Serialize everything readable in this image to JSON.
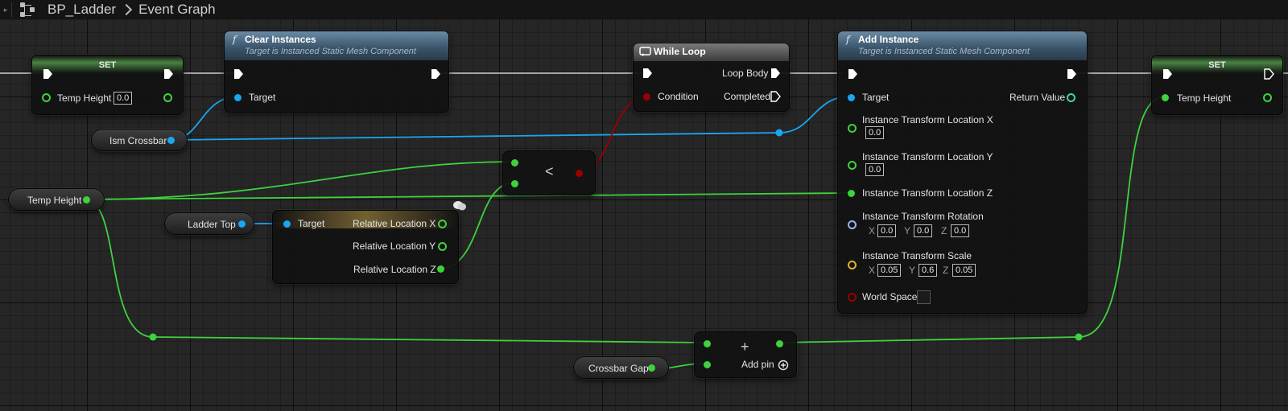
{
  "breadcrumb": {
    "asset": "BP_Ladder",
    "graph": "Event Graph"
  },
  "colors": {
    "exec": "#ffffff",
    "float": "#3fd23c",
    "object": "#1aa6f0",
    "bool": "#9b0000",
    "rotator": "#9eb1f2",
    "vector": "#e0b12e",
    "function_header": "#3c566c",
    "set_header": "#5aa650"
  },
  "nodes": {
    "set1": {
      "title": "SET",
      "pin_label": "Temp Height",
      "value": "0.0"
    },
    "clear_instances": {
      "title": "Clear Instances",
      "subtitle": "Target is Instanced Static Mesh Component",
      "target_label": "Target"
    },
    "ism_crossbar": {
      "label": "Ism Crossbar"
    },
    "temp_height": {
      "label": "Temp Height"
    },
    "ladder_top": {
      "label": "Ladder Top"
    },
    "relative_location": {
      "target_label": "Target",
      "x_label": "Relative Location X",
      "y_label": "Relative Location Y",
      "z_label": "Relative Location Z"
    },
    "less_than": {
      "op": "<"
    },
    "while_loop": {
      "title": "While Loop",
      "condition_label": "Condition",
      "loop_body_label": "Loop Body",
      "completed_label": "Completed"
    },
    "add_instance": {
      "title": "Add Instance",
      "subtitle": "Target is Instanced Static Mesh Component",
      "target_label": "Target",
      "return_label": "Return Value",
      "loc_x_label": "Instance Transform Location X",
      "loc_x_value": "0.0",
      "loc_y_label": "Instance Transform Location Y",
      "loc_y_value": "0.0",
      "loc_z_label": "Instance Transform Location Z",
      "rot_label": "Instance Transform Rotation",
      "rot": {
        "x_axis": "X",
        "x": "0.0",
        "y_axis": "Y",
        "y": "0.0",
        "z_axis": "Z",
        "z": "0.0"
      },
      "scale_label": "Instance Transform Scale",
      "scale": {
        "x_axis": "X",
        "x": "0.05",
        "y_axis": "Y",
        "y": "0.6",
        "z_axis": "Z",
        "z": "0.05"
      },
      "world_space_label": "World Space"
    },
    "set2": {
      "title": "SET",
      "pin_label": "Temp Height"
    },
    "crossbar_gap": {
      "label": "Crossbar Gap"
    },
    "add": {
      "op": "+",
      "add_pin_label": "Add pin"
    }
  }
}
